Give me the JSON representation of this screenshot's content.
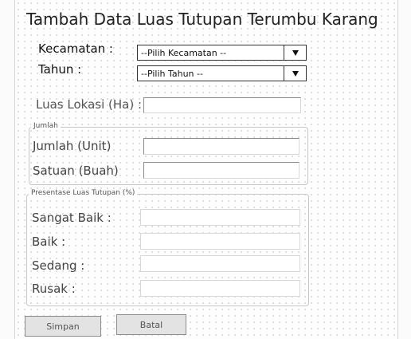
{
  "form": {
    "title": "Tambah Data Luas Tutupan Terumbu Karang",
    "kecamatan": {
      "label": "Kecamatan :",
      "selected": "--Pilih Kecamatan --"
    },
    "tahun": {
      "label": "Tahun :",
      "selected": "--Pilih Tahun --"
    },
    "luas_lokasi": {
      "label": "Luas Lokasi (Ha) :",
      "value": ""
    },
    "jumlah_group": {
      "legend": "Jumlah",
      "jumlah_unit": {
        "label": "Jumlah (Unit)",
        "value": ""
      },
      "satuan_buah": {
        "label": "Satuan (Buah)",
        "value": ""
      }
    },
    "presentase_group": {
      "legend": "Presentase Luas Tutupan (%)",
      "sangat_baik": {
        "label": "Sangat Baik :",
        "value": ""
      },
      "baik": {
        "label": "Baik :",
        "value": ""
      },
      "sedang": {
        "label": "Sedang :",
        "value": ""
      },
      "rusak": {
        "label": "Rusak :",
        "value": ""
      }
    },
    "buttons": {
      "simpan": "Simpan",
      "batal": "Batal"
    }
  },
  "icons": {
    "dropdown": "chevron-down-icon"
  }
}
